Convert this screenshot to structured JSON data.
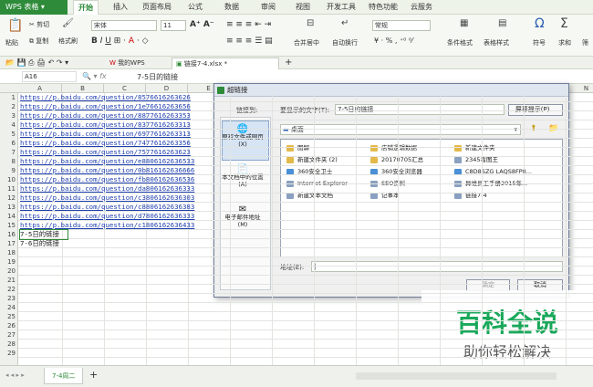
{
  "app": {
    "name": "WPS 表格"
  },
  "menu": {
    "tabs": [
      "开始",
      "插入",
      "页面布局",
      "公式",
      "数据",
      "审阅",
      "视图",
      "开发工具",
      "特色功能",
      "云服务"
    ],
    "active": "开始"
  },
  "ribbon": {
    "paste": "粘贴",
    "cut": "剪切",
    "copy": "复制",
    "format_painter": "格式刷",
    "font_name": "宋体",
    "font_size": "11",
    "merge": "合并居中",
    "wrap": "自动换行",
    "number_format": "常规",
    "cond_format": "条件格式",
    "table_style": "表格样式",
    "symbol": "符号",
    "sum": "求和",
    "filter": "筛"
  },
  "doc_tabs": [
    "我的WPS",
    "链接7-4.xlsx *"
  ],
  "formula_bar": {
    "cell_ref": "A16",
    "fx": "fx",
    "value": "7-5日的链接"
  },
  "grid": {
    "columns": [
      "A",
      "B",
      "C",
      "D",
      "E",
      "F",
      "G",
      "H",
      "I",
      "J",
      "K",
      "L",
      "M",
      "N"
    ],
    "rows": [
      "https://p.baidu.com/question/8576616263626",
      "https://p.baidu.com/question/1e76616263656",
      "https://p.baidu.com/question/8877616263353",
      "https://p.baidu.com/question/8377616263313",
      "https://p.baidu.com/question/6977616263313",
      "https://p.baidu.com/question/7477616263356",
      "https://p.baidu.com/question/7577616263623",
      "https://p.baidu.com/question/e8806162636533",
      "https://p.baidu.com/question/0b816162636666",
      "https://p.baidu.com/question/fb806162636536",
      "https://p.baidu.com/question/da806162636333",
      "https://p.baidu.com/question/c3806162636303",
      "https://p.baidu.com/question/c8806162636383",
      "https://p.baidu.com/question/d7806162636333",
      "https://p.baidu.com/question/c1806162636433",
      "7-5日的链接",
      "7-6日的链接"
    ],
    "row_count": 29
  },
  "sheet_tab": "7-4周二",
  "dialog": {
    "title": "超链接",
    "link_to": "链接到:",
    "display_text_label": "要显示的文字(T):",
    "display_text_value": "7-5日的链接",
    "screen_tip": "屏幕提示(P)...",
    "look_in_value": "桌面",
    "side": [
      "原有文件或网页(X)",
      "本文档中的位置(A)",
      "电子邮件地址(M)"
    ],
    "files": [
      [
        "图解",
        "店铺逻辑数据",
        "新建文件夹"
      ],
      [
        "新建文件夹 (2)",
        "20170705汇总",
        "2345看图王"
      ],
      [
        "360安全卫士",
        "360安全浏览器",
        "C8D8SZG LAQS8FP8..."
      ],
      [
        "Internet Explorer",
        "SEO资料",
        "异维员工手册2015年..."
      ],
      [
        "新建文本文档",
        "记事本",
        "链接7-4"
      ]
    ],
    "address_label": "地址(E):",
    "ok": "确定",
    "cancel": "取消"
  },
  "watermark": {
    "line1": "百科全说",
    "line2": "助你轻松解决"
  },
  "colors": {
    "accent": "#2e8b3a",
    "link": "#1f3fae"
  }
}
